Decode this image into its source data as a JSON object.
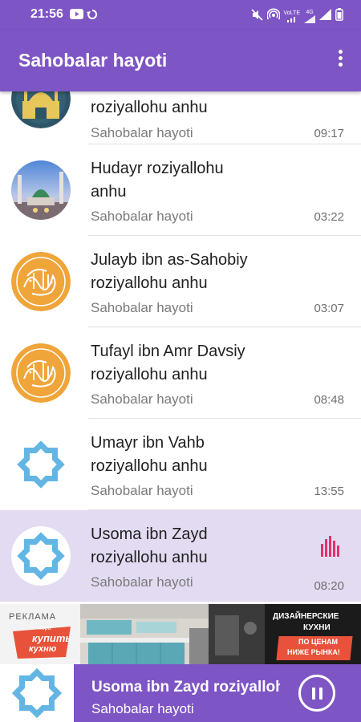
{
  "status_bar": {
    "time": "21:56",
    "icons": [
      "youtube-icon",
      "sync-icon",
      "mute-icon",
      "hotspot-icon",
      "volte-icon",
      "signal-icon",
      "wifi-icon",
      "battery-icon"
    ],
    "volte_label": "VoLTE",
    "lte_label": "4G"
  },
  "app_bar": {
    "title": "Sahobalar hayoti",
    "menu_icon": "more-vert-icon"
  },
  "colors": {
    "primary": "#7e55c4",
    "active_row": "#e3dbf2",
    "equalizer": "#e5316e"
  },
  "tracks": [
    {
      "title_line1": "",
      "title_line2": "roziyallohu anhu",
      "subtitle": "Sahobalar hayoti",
      "duration": "09:17",
      "thumb": "mosque-night-icon"
    },
    {
      "title_line1": "Hudayr roziyallohu",
      "title_line2": "anhu",
      "subtitle": "Sahobalar hayoti",
      "duration": "03:22",
      "thumb": "mosque-photo-icon"
    },
    {
      "title_line1": "Julayb ibn as-Sahobiy",
      "title_line2": "roziyallohu anhu",
      "subtitle": "Sahobalar hayoti",
      "duration": "03:07",
      "thumb": "calligraphy-medallion-icon"
    },
    {
      "title_line1": "Tufayl ibn Amr Davsiy",
      "title_line2": "roziyallohu anhu",
      "subtitle": "Sahobalar hayoti",
      "duration": "08:48",
      "thumb": "calligraphy-medallion-icon"
    },
    {
      "title_line1": "Umayr ibn Vahb",
      "title_line2": "roziyallohu anhu",
      "subtitle": "Sahobalar hayoti",
      "duration": "13:55",
      "thumb": "blue-star-icon"
    },
    {
      "title_line1": "Usoma ibn Zayd",
      "title_line2": "roziyallohu anhu",
      "subtitle": "Sahobalar hayoti",
      "duration": "08:20",
      "thumb": "blue-star-icon",
      "playing": true
    }
  ],
  "ad": {
    "label": "РЕКЛАМА",
    "logo_small": "пора",
    "logo_line1": "купить",
    "logo_line2": "кухню",
    "headline_line1": "ДИЗАЙНЕРСКИЕ",
    "headline_line2": "КУХНИ",
    "price_line1": "ПО ЦЕНАМ",
    "price_line2": "НИЖЕ РЫНКА!"
  },
  "now_playing": {
    "title": "Usoma ibn Zayd roziyallohu anhu",
    "subtitle": "Sahobalar hayoti",
    "control_icon": "pause-icon"
  }
}
